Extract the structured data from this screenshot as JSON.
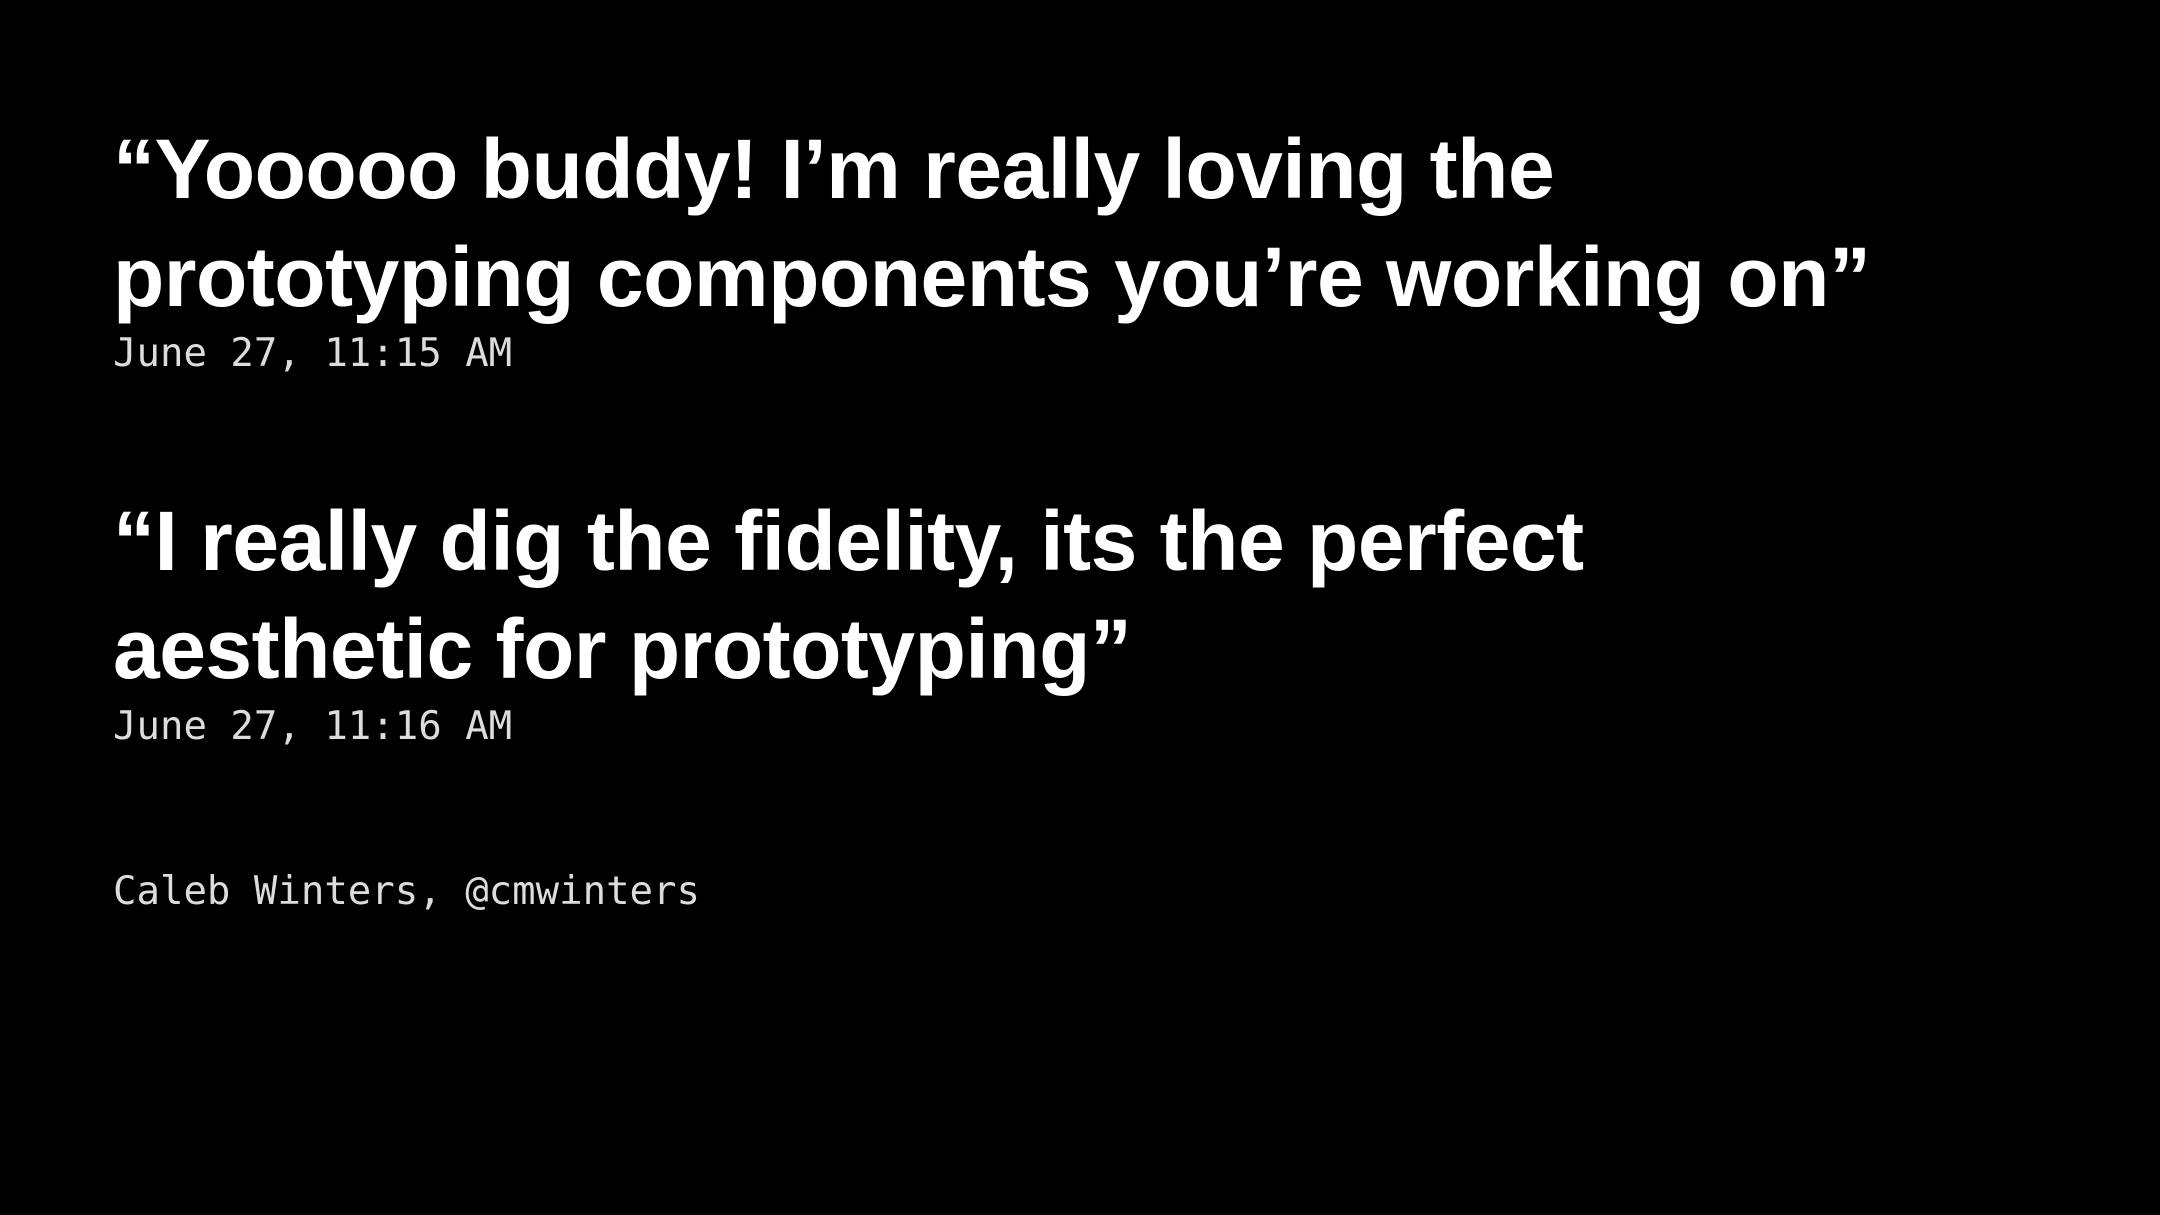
{
  "colors": {
    "background": "#000000",
    "quote_text": "#ffffff",
    "meta_text": "#dcdcdc"
  },
  "quotes": [
    {
      "lines": [
        "“Yooooo buddy! I’m really loving the",
        "prototyping components you’re working on”"
      ],
      "timestamp": "June 27, 11:15 AM"
    },
    {
      "lines": [
        "“I really dig the fidelity, its the perfect",
        "aesthetic for prototyping”"
      ],
      "timestamp": "June 27, 11:16 AM"
    }
  ],
  "attribution": "Caleb Winters, @cmwinters"
}
